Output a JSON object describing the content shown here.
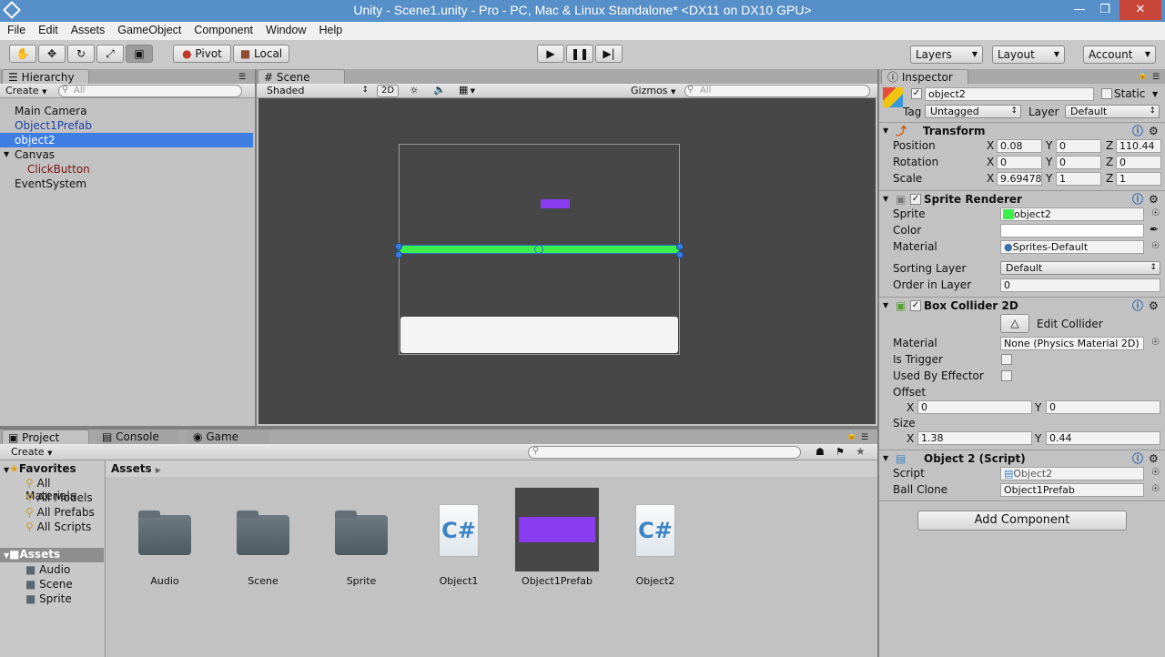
{
  "window": {
    "title": "Unity - Scene1.unity - Pro - PC, Mac & Linux Standalone* <DX11 on DX10 GPU>"
  },
  "menu": [
    "File",
    "Edit",
    "Assets",
    "GameObject",
    "Component",
    "Window",
    "Help"
  ],
  "toolbar": {
    "pivot": "Pivot",
    "local": "Local",
    "layers": "Layers",
    "layout": "Layout",
    "account": "Account"
  },
  "hierarchy": {
    "tab": "Hierarchy",
    "create": "Create",
    "search_placeholder": "All",
    "items": [
      {
        "label": "Main Camera"
      },
      {
        "label": "Object1Prefab"
      },
      {
        "label": "object2"
      },
      {
        "label": "Canvas"
      },
      {
        "label": "ClickButton"
      },
      {
        "label": "EventSystem"
      }
    ]
  },
  "scene": {
    "tab": "Scene",
    "shading": "Shaded",
    "mode2d": "2D",
    "gizmos": "Gizmos",
    "search_placeholder": "All",
    "colors": {
      "background": "#474747",
      "purple": "#8a3cf0",
      "green": "#3cf04b",
      "button": "#f4f4f4"
    }
  },
  "project": {
    "tabs": [
      "Project",
      "Console",
      "Game"
    ],
    "create": "Create",
    "breadcrumb": "Assets",
    "favorites_label": "Favorites",
    "favorites": [
      "All Materials",
      "All Models",
      "All Prefabs",
      "All Scripts"
    ],
    "assets_label": "Assets",
    "asset_folders": [
      "Audio",
      "Scene",
      "Sprite"
    ],
    "assets": [
      {
        "name": "Audio",
        "kind": "folder"
      },
      {
        "name": "Scene",
        "kind": "folder"
      },
      {
        "name": "Sprite",
        "kind": "folder"
      },
      {
        "name": "Object1",
        "kind": "script"
      },
      {
        "name": "Object1Prefab",
        "kind": "prefab"
      },
      {
        "name": "Object2",
        "kind": "script"
      }
    ]
  },
  "inspector": {
    "tab": "Inspector",
    "object_name": "object2",
    "static_label": "Static",
    "tag_label": "Tag",
    "tag_value": "Untagged",
    "layer_label": "Layer",
    "layer_value": "Default",
    "transform": {
      "title": "Transform",
      "position_label": "Position",
      "rotation_label": "Rotation",
      "scale_label": "Scale",
      "position": {
        "x": "0.08",
        "y": "0",
        "z": "110.44"
      },
      "rotation": {
        "x": "0",
        "y": "0",
        "z": "0"
      },
      "scale": {
        "x": "9.69478",
        "y": "1",
        "z": "1"
      }
    },
    "sprite_renderer": {
      "title": "Sprite Renderer",
      "sprite_label": "Sprite",
      "sprite_value": "object2",
      "color_label": "Color",
      "material_label": "Material",
      "material_value": "Sprites-Default",
      "sorting_layer_label": "Sorting Layer",
      "sorting_layer_value": "Default",
      "order_label": "Order in Layer",
      "order_value": "0"
    },
    "box_collider": {
      "title": "Box Collider 2D",
      "edit_collider": "Edit Collider",
      "material_label": "Material",
      "material_value": "None (Physics Material 2D)",
      "is_trigger_label": "Is Trigger",
      "used_by_effector_label": "Used By Effector",
      "offset_label": "Offset",
      "offset": {
        "x": "0",
        "y": "0"
      },
      "size_label": "Size",
      "size": {
        "x": "1.38",
        "y": "0.44"
      }
    },
    "script": {
      "title": "Object 2 (Script)",
      "script_label": "Script",
      "script_value": "Object2",
      "ball_clone_label": "Ball Clone",
      "ball_clone_value": "Object1Prefab"
    },
    "add_component": "Add Component"
  }
}
